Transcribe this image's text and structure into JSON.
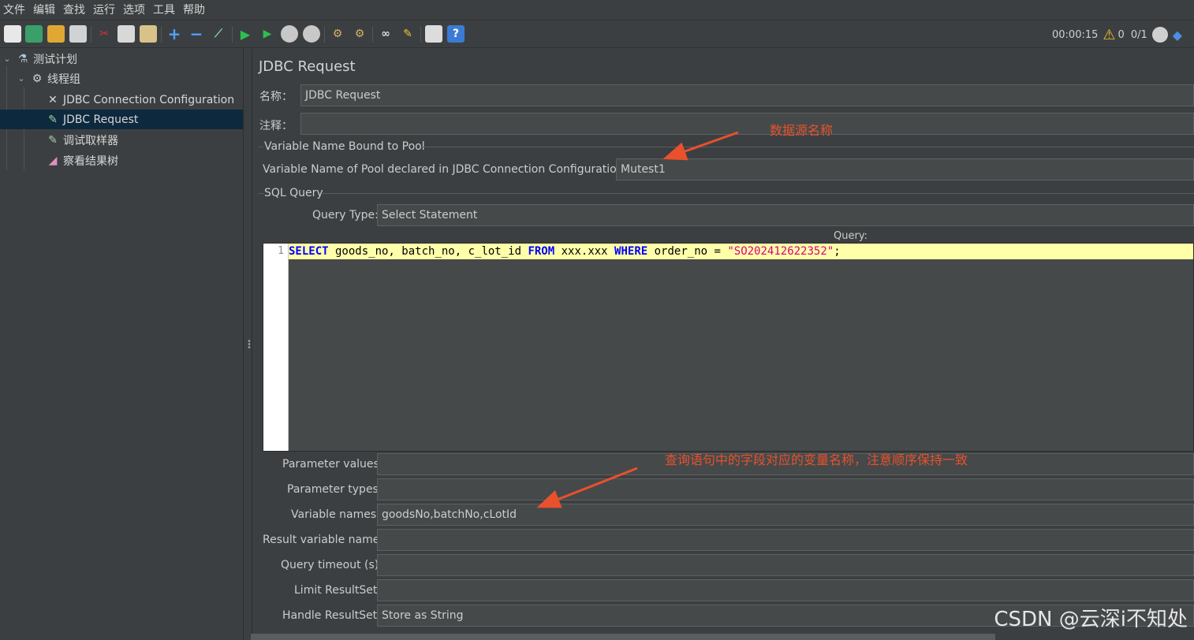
{
  "menu": [
    "文件",
    "编辑",
    "查找",
    "运行",
    "选项",
    "工具",
    "帮助"
  ],
  "toolbar": {
    "icons": [
      "new-icon",
      "templates-icon",
      "open-icon",
      "save-icon",
      "cut-icon",
      "copy-icon",
      "paste-icon",
      "expand-icon",
      "collapse-icon",
      "toggle-icon",
      "start-icon",
      "start-no-pause-icon",
      "stop-icon",
      "shutdown-icon",
      "clear-icon",
      "clear-all-icon",
      "search-icon",
      "reset-search-icon",
      "function-helper-icon",
      "help-icon"
    ],
    "timer": "00:00:15",
    "warning_count": "0",
    "threads": "0/1"
  },
  "tree": {
    "items": [
      {
        "label": "测试计划",
        "icon": "test-plan-icon"
      },
      {
        "label": "线程组",
        "icon": "thread-group-icon"
      },
      {
        "label": "JDBC Connection Configuration",
        "icon": "config-tools-icon"
      },
      {
        "label": "JDBC Request",
        "icon": "sampler-icon"
      },
      {
        "label": "调试取样器",
        "icon": "sampler-icon"
      },
      {
        "label": "察看结果树",
        "icon": "listener-icon"
      }
    ]
  },
  "panel": {
    "title": "JDBC Request",
    "name_label": "名称：",
    "name_value": "JDBC Request",
    "comment_label": "注释：",
    "comment_value": "",
    "pool_group": "Variable Name Bound to Pool",
    "pool_label": "Variable Name of Pool declared in JDBC Connection Configuration:",
    "pool_value": "Mutest1",
    "sql_group": "SQL Query",
    "query_type_label": "Query Type:",
    "query_type_value": "Select Statement",
    "query_label": "Query:",
    "line_number": "1",
    "sql": {
      "kw1": "SELECT",
      "part1": " goods_no, batch_no, c_lot_id ",
      "kw2": "FROM",
      "part2": " xxx.xxx ",
      "kw3": "WHERE",
      "part3": " order_no = ",
      "string": "\"SO202412622352\"",
      "end": ";"
    },
    "param_values_label": "Parameter values:",
    "param_values": "",
    "param_types_label": "Parameter types:",
    "param_types": "",
    "var_names_label": "Variable names:",
    "var_names": "goodsNo,batchNo,cLotId",
    "result_var_label": "Result variable name:",
    "result_var": "",
    "timeout_label": "Query timeout (s):",
    "timeout": "",
    "limit_label": "Limit ResultSet:",
    "limit": "",
    "handle_label": "Handle ResultSet:",
    "handle": "Store as String"
  },
  "annotations": {
    "pool_note": "数据源名称",
    "vars_note": "查询语句中的字段对应的变量名称，注意顺序保持一致",
    "color": "#e8512c"
  },
  "watermark": "CSDN @云深i不知处"
}
